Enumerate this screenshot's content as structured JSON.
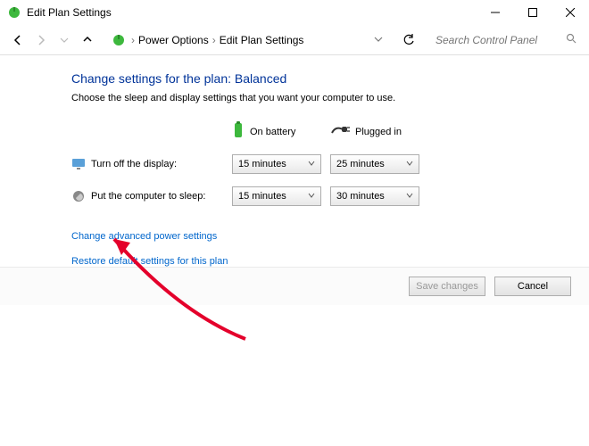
{
  "window": {
    "title": "Edit Plan Settings"
  },
  "breadcrumb": {
    "seg1": "Power Options",
    "seg2": "Edit Plan Settings"
  },
  "search": {
    "placeholder": "Search Control Panel"
  },
  "page": {
    "heading": "Change settings for the plan: Balanced",
    "subhead": "Choose the sleep and display settings that you want your computer to use."
  },
  "columns": {
    "battery": "On battery",
    "plugged": "Plugged in"
  },
  "rows": {
    "display": {
      "label": "Turn off the display:",
      "battery": "15 minutes",
      "plugged": "25 minutes"
    },
    "sleep": {
      "label": "Put the computer to sleep:",
      "battery": "15 minutes",
      "plugged": "30 minutes"
    }
  },
  "links": {
    "advanced": "Change advanced power settings",
    "restore": "Restore default settings for this plan"
  },
  "buttons": {
    "save": "Save changes",
    "cancel": "Cancel"
  }
}
